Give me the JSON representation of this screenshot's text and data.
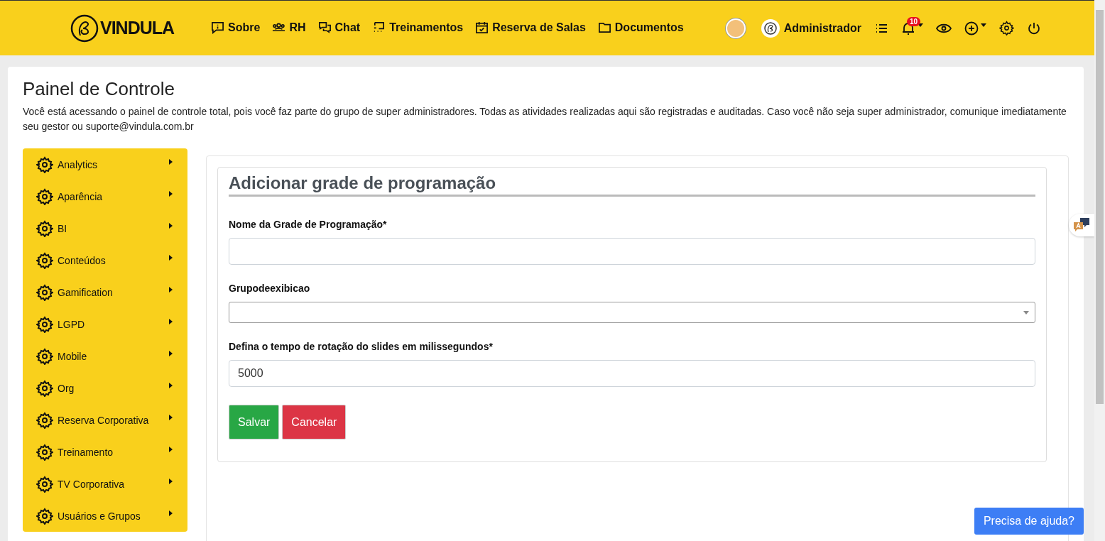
{
  "header": {
    "logo": "VINDULA",
    "nav": [
      {
        "kind": "info",
        "label": "Sobre"
      },
      {
        "kind": "people",
        "label": "RH"
      },
      {
        "kind": "chat",
        "label": "Chat"
      },
      {
        "kind": "training",
        "label": "Treinamentos"
      },
      {
        "kind": "calendar",
        "label": "Reserva de Salas"
      },
      {
        "kind": "folder",
        "label": "Documentos"
      }
    ],
    "user": {
      "name": "Administrador"
    },
    "notifications": {
      "count": "10"
    }
  },
  "page": {
    "title": "Painel de Controle",
    "description": "Você está acessando o painel de controle total, pois você faz parte do grupo de super administradores. Todas as atividades realizadas aqui são registradas e auditadas. Caso você não seja super administrador, comunique imediatamente seu gestor ou suporte@vindula.com.br"
  },
  "sidebar": {
    "items": [
      {
        "label": "Analytics"
      },
      {
        "label": "Aparência"
      },
      {
        "label": "BI"
      },
      {
        "label": "Conteúdos"
      },
      {
        "label": "Gamification"
      },
      {
        "label": "LGPD"
      },
      {
        "label": "Mobile"
      },
      {
        "label": "Org"
      },
      {
        "label": "Reserva Corporativa"
      },
      {
        "label": "Treinamento"
      },
      {
        "label": "TV Corporativa"
      },
      {
        "label": "Usuários e Grupos"
      }
    ]
  },
  "form": {
    "title": "Adicionar grade de programação",
    "fields": [
      {
        "kind": "text",
        "label": "Nome da Grade de Programação*"
      },
      {
        "kind": "select",
        "label": "Grupodeexibicao"
      },
      {
        "kind": "text",
        "label": "Defina o tempo de rotação do slides em milissegundos*",
        "value": "5000"
      }
    ],
    "buttons": [
      {
        "kind": "success",
        "label": "Salvar"
      },
      {
        "kind": "danger",
        "label": "Cancelar"
      }
    ]
  },
  "help_button": {
    "label": "Precisa de ajuda?"
  }
}
